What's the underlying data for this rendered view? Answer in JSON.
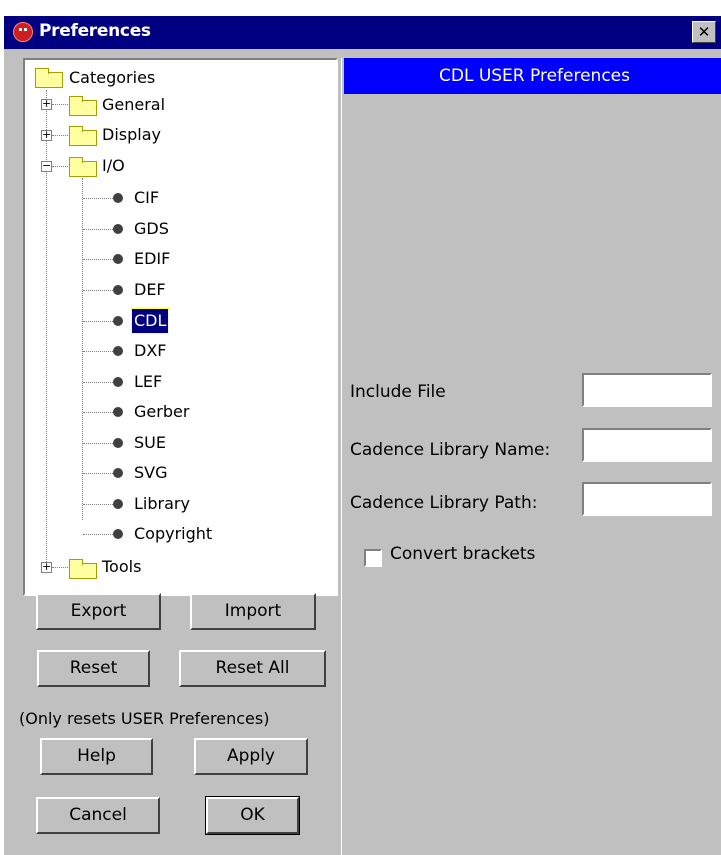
{
  "window": {
    "title": "Preferences",
    "close_glyph": "✕",
    "title_icon": "electric-app-icon"
  },
  "tree": {
    "root": "Categories",
    "general": "General",
    "display": "Display",
    "io": "I/O",
    "io_children": [
      "CIF",
      "GDS",
      "EDIF",
      "DEF",
      "CDL",
      "DXF",
      "LEF",
      "Gerber",
      "SUE",
      "SVG",
      "Library",
      "Copyright"
    ],
    "selected": "CDL",
    "tools": "Tools"
  },
  "buttons": {
    "export": "Export",
    "import": "Import",
    "reset": "Reset",
    "reset_all": "Reset All",
    "help": "Help",
    "apply": "Apply",
    "cancel": "Cancel",
    "ok": "OK"
  },
  "reset_note": "(Only resets USER Preferences)",
  "panel": {
    "header": "CDL USER Preferences",
    "include_file_label": "Include File",
    "include_file_value": "",
    "library_name_label": "Cadence Library Name:",
    "library_name_value": "",
    "library_path_label": "Cadence Library Path:",
    "library_path_value": "",
    "convert_brackets_label": "Convert brackets",
    "convert_brackets_checked": false
  },
  "colors": {
    "title_bar": "#000080",
    "panel_header": "#0000ff",
    "dialog_bg": "#c0c0c0",
    "selection": "#000080"
  }
}
